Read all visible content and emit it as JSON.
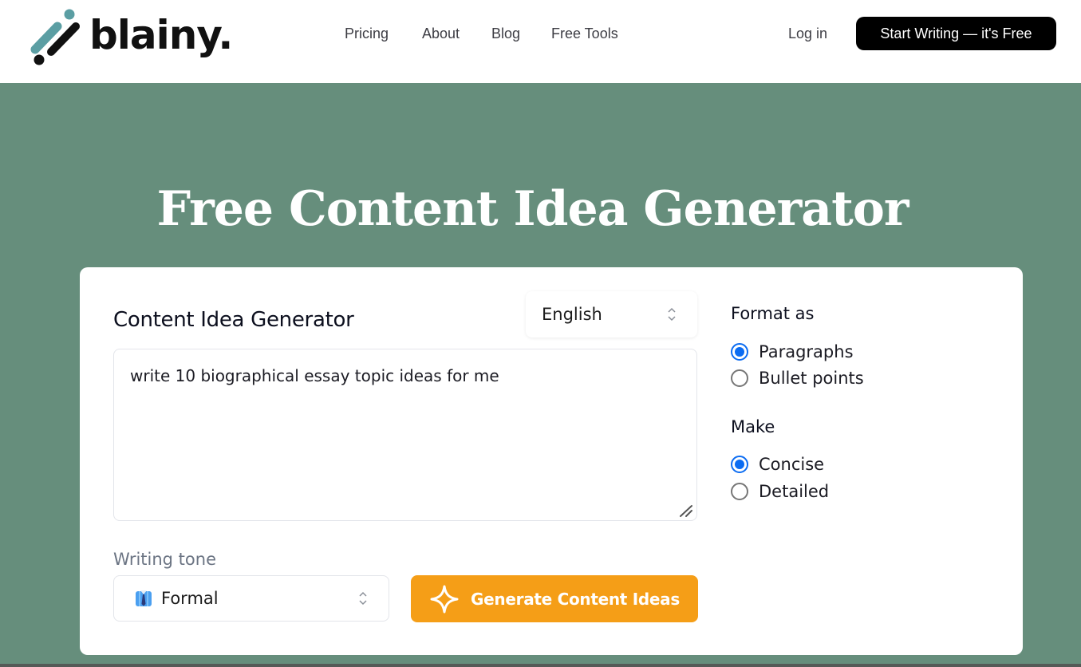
{
  "header": {
    "brand": "blainy.",
    "nav": [
      {
        "label": "Pricing"
      },
      {
        "label": "About"
      },
      {
        "label": "Blog"
      },
      {
        "label": "Free Tools"
      }
    ],
    "login_label": "Log in",
    "cta_label": "Start Writing — it's Free"
  },
  "hero": {
    "title": "Free Content Idea Generator"
  },
  "card": {
    "title": "Content Idea Generator",
    "language": {
      "selected": "English",
      "icon": "up-down-chevron-icon"
    },
    "prompt": {
      "value": "write 10 biographical essay topic ideas for me",
      "placeholder": ""
    },
    "format": {
      "heading": "Format as",
      "options": [
        {
          "label": "Paragraphs",
          "checked": true
        },
        {
          "label": "Bullet points",
          "checked": false
        }
      ]
    },
    "make": {
      "heading": "Make",
      "options": [
        {
          "label": "Concise",
          "checked": true
        },
        {
          "label": "Detailed",
          "checked": false
        }
      ]
    },
    "tone": {
      "label": "Writing tone",
      "selected": "Formal",
      "icon": "suit-tie-icon"
    },
    "generate_label": "Generate Content Ideas",
    "generate_icon": "sparkle-icon"
  },
  "colors": {
    "background": "#668e7c",
    "accent": "#f59e17",
    "radio_selected": "#0b6cf2",
    "logo_teal": "#5b9ea3",
    "cta_bg": "#000000"
  }
}
